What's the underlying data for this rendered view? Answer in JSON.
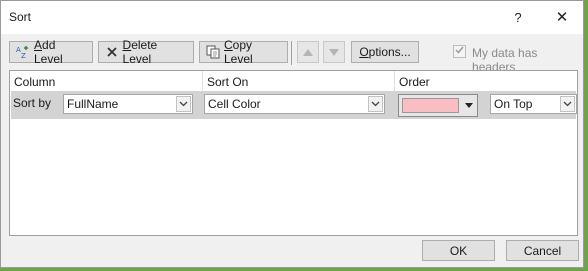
{
  "window": {
    "title": "Sort",
    "help_glyph": "?",
    "close_glyph": "✕"
  },
  "toolbar": {
    "add_level": {
      "accel": "A",
      "rest": "dd Level"
    },
    "delete_level": {
      "accel": "D",
      "rest": "elete Level"
    },
    "copy_level": {
      "accel": "C",
      "rest": "opy Level"
    },
    "options": {
      "accel": "O",
      "rest": "ptions..."
    },
    "move_up_icon": "up-arrow-icon",
    "move_down_icon": "down-arrow-icon",
    "headers_checkbox": {
      "checked": true,
      "label_before": "My data has ",
      "accel": "h",
      "label_after": "eaders"
    }
  },
  "grid": {
    "headers": {
      "column": "Column",
      "sort_on": "Sort On",
      "order": "Order"
    },
    "rows": [
      {
        "label": "Sort by",
        "column": "FullName",
        "sort_on": "Cell Color",
        "order_color": "#f9bec4",
        "order_position": "On Top"
      }
    ]
  },
  "footer": {
    "ok": "OK",
    "cancel": "Cancel"
  },
  "colors": {
    "desktop": "#6fa54a",
    "dialog": "#f0f0f0",
    "row_selected": "#d3d3d3"
  }
}
